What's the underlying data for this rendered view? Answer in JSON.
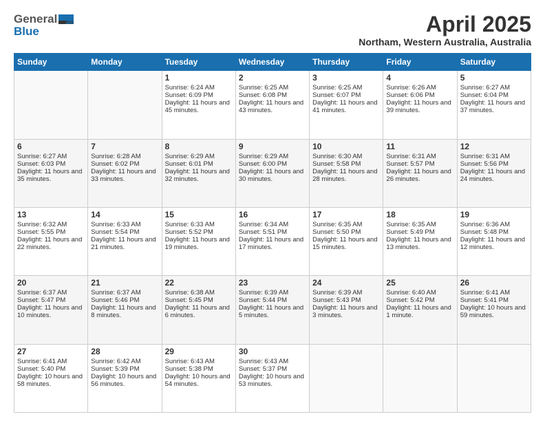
{
  "header": {
    "logo_general": "General",
    "logo_blue": "Blue",
    "month": "April 2025",
    "location": "Northam, Western Australia, Australia"
  },
  "days_of_week": [
    "Sunday",
    "Monday",
    "Tuesday",
    "Wednesday",
    "Thursday",
    "Friday",
    "Saturday"
  ],
  "weeks": [
    [
      {
        "day": "",
        "sunrise": "",
        "sunset": "",
        "daylight": ""
      },
      {
        "day": "",
        "sunrise": "",
        "sunset": "",
        "daylight": ""
      },
      {
        "day": "1",
        "sunrise": "Sunrise: 6:24 AM",
        "sunset": "Sunset: 6:09 PM",
        "daylight": "Daylight: 11 hours and 45 minutes."
      },
      {
        "day": "2",
        "sunrise": "Sunrise: 6:25 AM",
        "sunset": "Sunset: 6:08 PM",
        "daylight": "Daylight: 11 hours and 43 minutes."
      },
      {
        "day": "3",
        "sunrise": "Sunrise: 6:25 AM",
        "sunset": "Sunset: 6:07 PM",
        "daylight": "Daylight: 11 hours and 41 minutes."
      },
      {
        "day": "4",
        "sunrise": "Sunrise: 6:26 AM",
        "sunset": "Sunset: 6:06 PM",
        "daylight": "Daylight: 11 hours and 39 minutes."
      },
      {
        "day": "5",
        "sunrise": "Sunrise: 6:27 AM",
        "sunset": "Sunset: 6:04 PM",
        "daylight": "Daylight: 11 hours and 37 minutes."
      }
    ],
    [
      {
        "day": "6",
        "sunrise": "Sunrise: 6:27 AM",
        "sunset": "Sunset: 6:03 PM",
        "daylight": "Daylight: 11 hours and 35 minutes."
      },
      {
        "day": "7",
        "sunrise": "Sunrise: 6:28 AM",
        "sunset": "Sunset: 6:02 PM",
        "daylight": "Daylight: 11 hours and 33 minutes."
      },
      {
        "day": "8",
        "sunrise": "Sunrise: 6:29 AM",
        "sunset": "Sunset: 6:01 PM",
        "daylight": "Daylight: 11 hours and 32 minutes."
      },
      {
        "day": "9",
        "sunrise": "Sunrise: 6:29 AM",
        "sunset": "Sunset: 6:00 PM",
        "daylight": "Daylight: 11 hours and 30 minutes."
      },
      {
        "day": "10",
        "sunrise": "Sunrise: 6:30 AM",
        "sunset": "Sunset: 5:58 PM",
        "daylight": "Daylight: 11 hours and 28 minutes."
      },
      {
        "day": "11",
        "sunrise": "Sunrise: 6:31 AM",
        "sunset": "Sunset: 5:57 PM",
        "daylight": "Daylight: 11 hours and 26 minutes."
      },
      {
        "day": "12",
        "sunrise": "Sunrise: 6:31 AM",
        "sunset": "Sunset: 5:56 PM",
        "daylight": "Daylight: 11 hours and 24 minutes."
      }
    ],
    [
      {
        "day": "13",
        "sunrise": "Sunrise: 6:32 AM",
        "sunset": "Sunset: 5:55 PM",
        "daylight": "Daylight: 11 hours and 22 minutes."
      },
      {
        "day": "14",
        "sunrise": "Sunrise: 6:33 AM",
        "sunset": "Sunset: 5:54 PM",
        "daylight": "Daylight: 11 hours and 21 minutes."
      },
      {
        "day": "15",
        "sunrise": "Sunrise: 6:33 AM",
        "sunset": "Sunset: 5:52 PM",
        "daylight": "Daylight: 11 hours and 19 minutes."
      },
      {
        "day": "16",
        "sunrise": "Sunrise: 6:34 AM",
        "sunset": "Sunset: 5:51 PM",
        "daylight": "Daylight: 11 hours and 17 minutes."
      },
      {
        "day": "17",
        "sunrise": "Sunrise: 6:35 AM",
        "sunset": "Sunset: 5:50 PM",
        "daylight": "Daylight: 11 hours and 15 minutes."
      },
      {
        "day": "18",
        "sunrise": "Sunrise: 6:35 AM",
        "sunset": "Sunset: 5:49 PM",
        "daylight": "Daylight: 11 hours and 13 minutes."
      },
      {
        "day": "19",
        "sunrise": "Sunrise: 6:36 AM",
        "sunset": "Sunset: 5:48 PM",
        "daylight": "Daylight: 11 hours and 12 minutes."
      }
    ],
    [
      {
        "day": "20",
        "sunrise": "Sunrise: 6:37 AM",
        "sunset": "Sunset: 5:47 PM",
        "daylight": "Daylight: 11 hours and 10 minutes."
      },
      {
        "day": "21",
        "sunrise": "Sunrise: 6:37 AM",
        "sunset": "Sunset: 5:46 PM",
        "daylight": "Daylight: 11 hours and 8 minutes."
      },
      {
        "day": "22",
        "sunrise": "Sunrise: 6:38 AM",
        "sunset": "Sunset: 5:45 PM",
        "daylight": "Daylight: 11 hours and 6 minutes."
      },
      {
        "day": "23",
        "sunrise": "Sunrise: 6:39 AM",
        "sunset": "Sunset: 5:44 PM",
        "daylight": "Daylight: 11 hours and 5 minutes."
      },
      {
        "day": "24",
        "sunrise": "Sunrise: 6:39 AM",
        "sunset": "Sunset: 5:43 PM",
        "daylight": "Daylight: 11 hours and 3 minutes."
      },
      {
        "day": "25",
        "sunrise": "Sunrise: 6:40 AM",
        "sunset": "Sunset: 5:42 PM",
        "daylight": "Daylight: 11 hours and 1 minute."
      },
      {
        "day": "26",
        "sunrise": "Sunrise: 6:41 AM",
        "sunset": "Sunset: 5:41 PM",
        "daylight": "Daylight: 10 hours and 59 minutes."
      }
    ],
    [
      {
        "day": "27",
        "sunrise": "Sunrise: 6:41 AM",
        "sunset": "Sunset: 5:40 PM",
        "daylight": "Daylight: 10 hours and 58 minutes."
      },
      {
        "day": "28",
        "sunrise": "Sunrise: 6:42 AM",
        "sunset": "Sunset: 5:39 PM",
        "daylight": "Daylight: 10 hours and 56 minutes."
      },
      {
        "day": "29",
        "sunrise": "Sunrise: 6:43 AM",
        "sunset": "Sunset: 5:38 PM",
        "daylight": "Daylight: 10 hours and 54 minutes."
      },
      {
        "day": "30",
        "sunrise": "Sunrise: 6:43 AM",
        "sunset": "Sunset: 5:37 PM",
        "daylight": "Daylight: 10 hours and 53 minutes."
      },
      {
        "day": "",
        "sunrise": "",
        "sunset": "",
        "daylight": ""
      },
      {
        "day": "",
        "sunrise": "",
        "sunset": "",
        "daylight": ""
      },
      {
        "day": "",
        "sunrise": "",
        "sunset": "",
        "daylight": ""
      }
    ]
  ]
}
